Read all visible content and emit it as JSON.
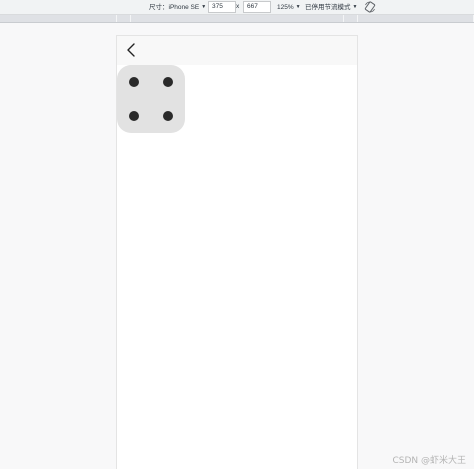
{
  "devtools": {
    "device_label": "尺寸：iPhone SE",
    "width_value": "375",
    "times_sign": "x",
    "height_value": "667",
    "zoom_label": "125%",
    "throttle_label": "已停用节流模式"
  },
  "icons": {
    "dropdown": "caret-down-icon",
    "rotate": "rotate-icon",
    "back": "chevron-left-icon"
  },
  "dice": {
    "face_value": 4,
    "face_color": "#e2e2e2",
    "pip_color": "#2a2a2a"
  },
  "watermark": "CSDN @虾米大王"
}
